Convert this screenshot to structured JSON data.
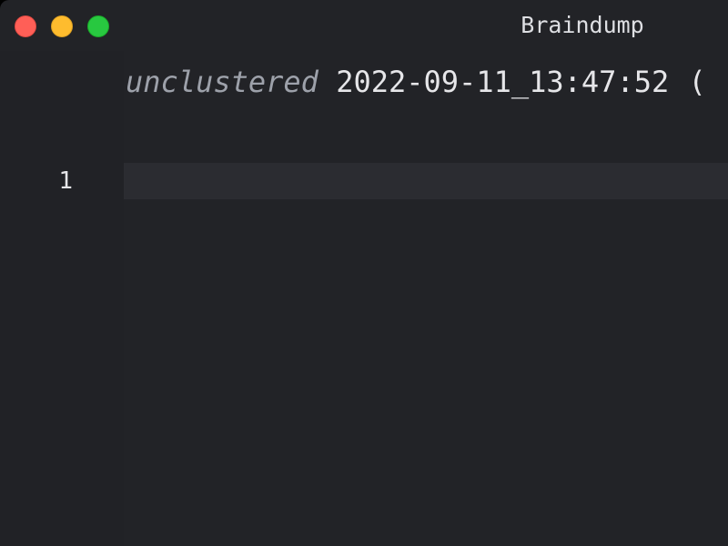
{
  "window": {
    "title": "Braindump"
  },
  "traffic_lights": {
    "close_color": "#ff5f57",
    "minimize_color": "#febc2e",
    "zoom_color": "#28c840"
  },
  "editor": {
    "cluster_label": "unclustered",
    "timestamp": "2022-09-11_13:47:52",
    "overflow_glyph": "(",
    "lines": [
      {
        "number": "1",
        "text": ""
      }
    ]
  },
  "theme": {
    "background": "#222327",
    "current_line": "#2b2c31",
    "muted_text": "#9da1aa",
    "text": "#e6e6e9"
  }
}
